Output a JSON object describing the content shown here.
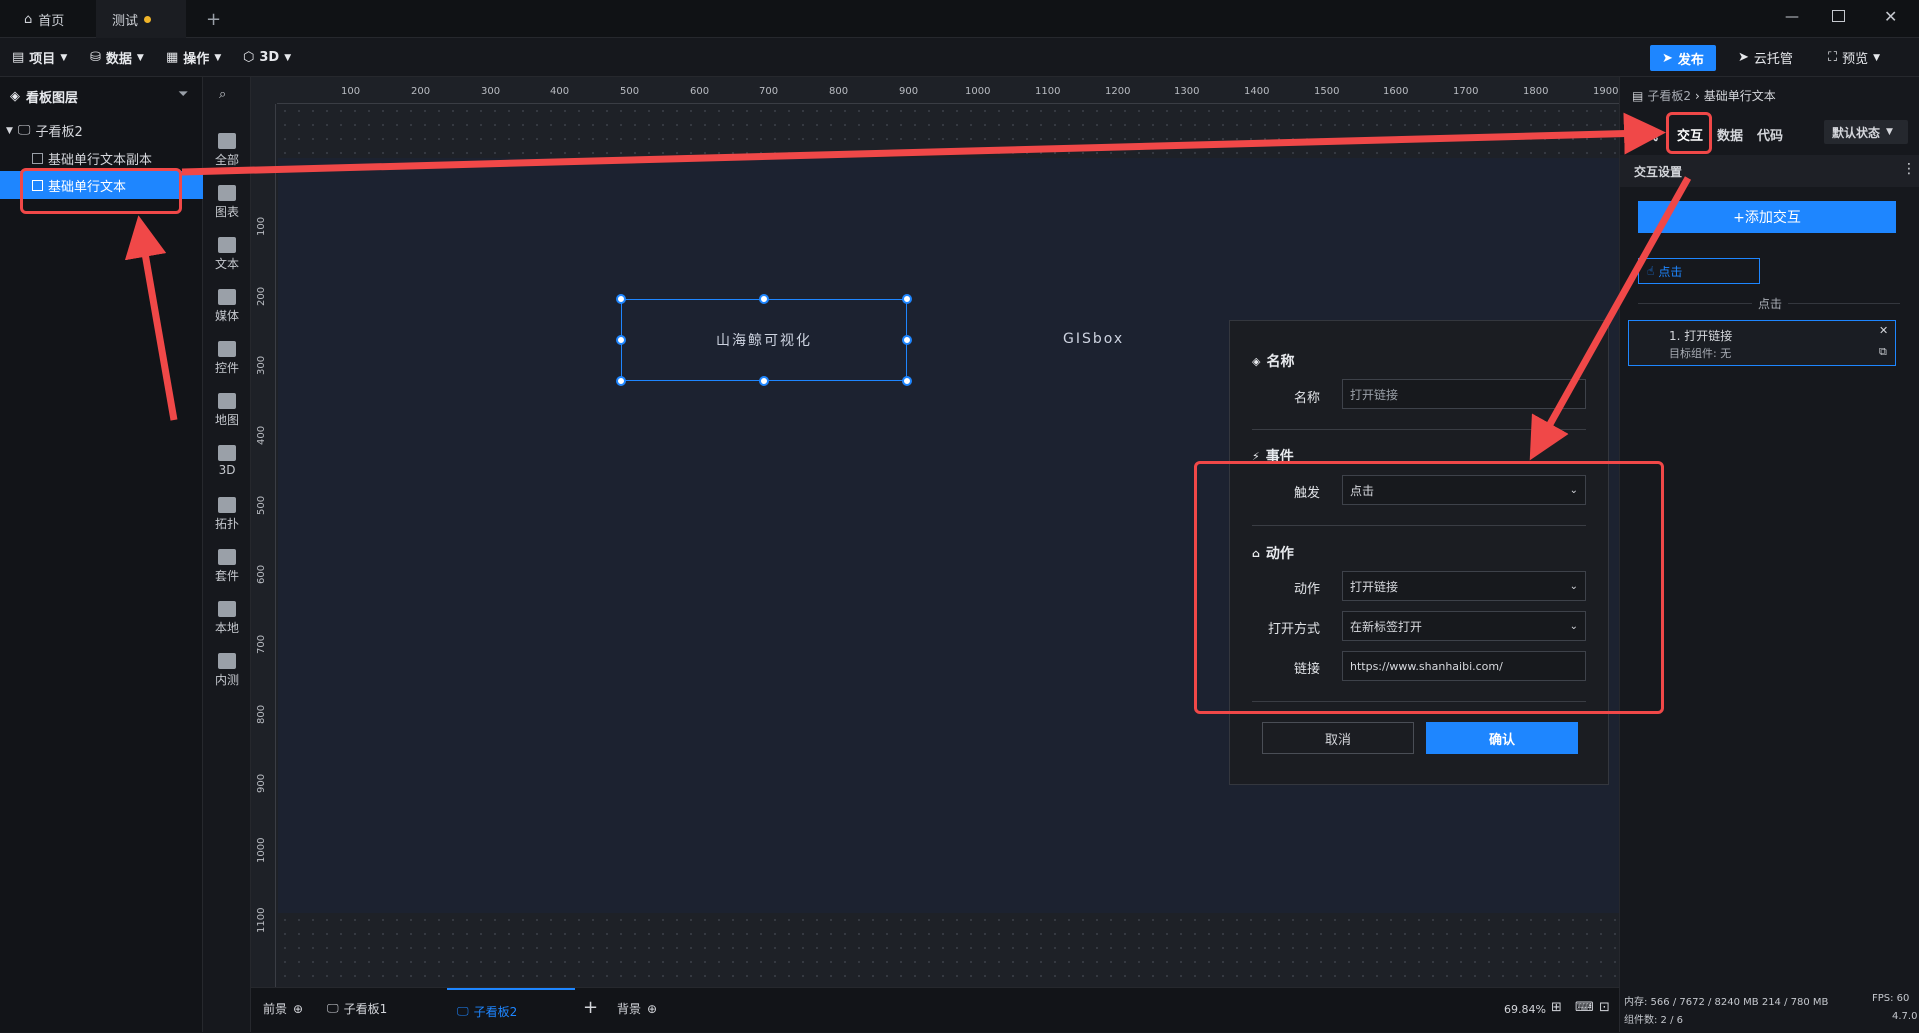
{
  "tabs": [
    {
      "label": "首页"
    },
    {
      "label": "测试"
    }
  ],
  "toolbar": {
    "project": "项目",
    "data": "数据",
    "operate": "操作",
    "threed": "3D",
    "publish": "发布",
    "cloud": "云托管",
    "preview": "预览"
  },
  "layers": {
    "title": "看板图层",
    "root": "子看板2",
    "items": [
      "基础单行文本副本",
      "基础单行文本"
    ]
  },
  "components": [
    "全部",
    "图表",
    "文本",
    "媒体",
    "控件",
    "地图",
    "3D",
    "拓扑",
    "套件",
    "本地",
    "内测"
  ],
  "ruler": {
    "top": [
      "100",
      "200",
      "300",
      "400",
      "500",
      "600",
      "700",
      "800",
      "900",
      "1000",
      "1100",
      "1200",
      "1300",
      "1400",
      "1500",
      "1600",
      "1700",
      "1800",
      "1900"
    ],
    "left": [
      "100",
      "200",
      "300",
      "400",
      "500",
      "600",
      "700",
      "800",
      "900",
      "1000",
      "1100"
    ]
  },
  "canvas": {
    "text1": "山海鲸可视化",
    "text2": "GISbox"
  },
  "bottom": {
    "front": "前景",
    "board1": "子看板1",
    "board2": "子看板2",
    "background": "背景",
    "zoom": "69.84%"
  },
  "right": {
    "crumb_parent": "子看板2",
    "crumb_current": "基础单行文本",
    "tab_style": "样式",
    "tab_interact": "交互",
    "tab_data": "数据",
    "tab_code": "代码",
    "state": "默认状态",
    "section": "交互设置",
    "add": "+添加交互",
    "trigger_tag": "点击",
    "group_label": "点击",
    "item_title": "1. 打开链接",
    "item_sub": "目标组件: 无",
    "mem": "内存:  566 / 7672 / 8240 MB  214 / 780 MB",
    "fps": "FPS:  60",
    "count": "组件数: 2 / 6",
    "version": "4.7.0"
  },
  "dialog": {
    "name_section": "名称",
    "name_label": "名称",
    "name_value": "打开链接",
    "event_section": "事件",
    "trigger_label": "触发",
    "trigger_value": "点击",
    "action_section": "动作",
    "action_label": "动作",
    "action_value": "打开链接",
    "open_label": "打开方式",
    "open_value": "在新标签打开",
    "link_label": "链接",
    "link_value": "https://www.shanhaibi.com/",
    "cancel": "取消",
    "confirm": "确认"
  },
  "colors": {
    "accent": "#1e86ff",
    "annotation": "#f04848"
  }
}
